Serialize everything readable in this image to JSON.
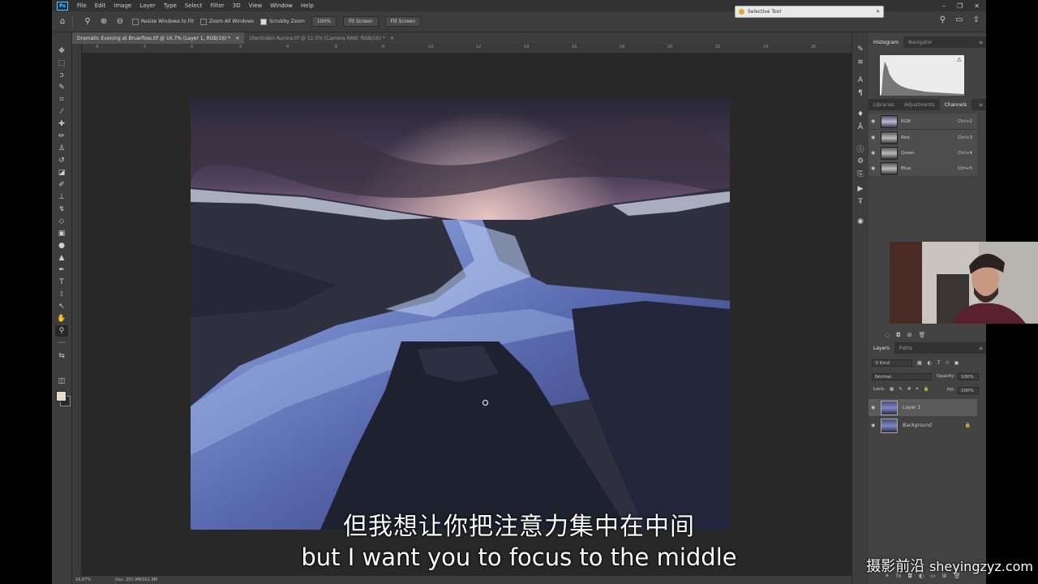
{
  "app": {
    "logo": "Ps",
    "menu": [
      "File",
      "Edit",
      "Image",
      "Layer",
      "Type",
      "Select",
      "Filter",
      "3D",
      "View",
      "Window",
      "Help"
    ],
    "window_controls": [
      "–",
      "❐",
      "✕"
    ]
  },
  "options_bar": {
    "resize_windows_label": "Resize Windows to Fit",
    "zoom_all_label": "Zoom All Windows",
    "scrubby_zoom_label": "Scrubby Zoom",
    "zoom_value": "100%",
    "fit_screen": "Fit Screen",
    "fill_screen": "Fill Screen"
  },
  "selective_tool": {
    "label": "Selective Tool"
  },
  "documents": {
    "tabs": [
      {
        "label": "Dramatic Evening at Bruarfoss.tif @ 16.7% (Layer 1, RGB/16) *",
        "active": true
      },
      {
        "label": "Oterlinden Aurora.tif @ 12.5% (Camera RAW, RGB/16) *",
        "active": false
      }
    ]
  },
  "ruler": {
    "ticks": [
      "4",
      "2",
      "0",
      "2",
      "4",
      "6",
      "8",
      "10",
      "12",
      "14",
      "16",
      "18",
      "20",
      "22",
      "24",
      "26"
    ]
  },
  "status": {
    "zoom": "16.67%",
    "doc": "Doc: 201.9M/201.9M"
  },
  "histogram_panel": {
    "tabs": [
      "Histogram",
      "Navigator"
    ]
  },
  "channels_panel": {
    "tabs": [
      "Libraries",
      "Adjustments",
      "Channels"
    ],
    "channels": [
      {
        "name": "RGB",
        "shortcut": "Ctrl+2"
      },
      {
        "name": "Red",
        "shortcut": "Ctrl+3"
      },
      {
        "name": "Green",
        "shortcut": "Ctrl+4"
      },
      {
        "name": "Blue",
        "shortcut": "Ctrl+5"
      }
    ]
  },
  "layers_panel": {
    "tabs": [
      "Layers",
      "Paths"
    ],
    "filter_kind": "Kind",
    "blend_mode": "Normal",
    "opacity_label": "Opacity:",
    "opacity_value": "100%",
    "lock_label": "Lock:",
    "fill_label": "Fill:",
    "fill_value": "100%",
    "layers": [
      {
        "name": "Layer 1",
        "selected": true
      },
      {
        "name": "Background",
        "selected": false
      }
    ]
  },
  "subtitles": {
    "zh": "但我想让你把注意力集中在中间",
    "en": "but I want you to focus to the middle"
  },
  "watermark": {
    "zh": "摄影前沿",
    "url": "sheyingzyz.com"
  }
}
